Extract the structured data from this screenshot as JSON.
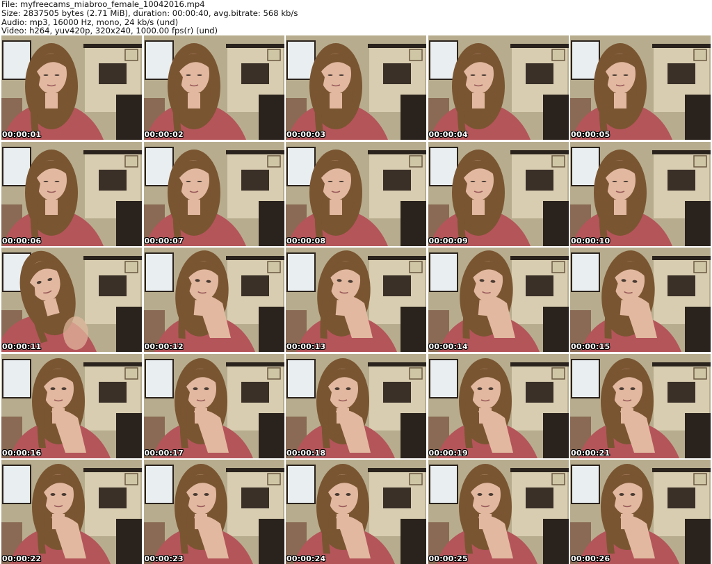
{
  "header": {
    "file_line": "File: myfreecams_miabroo_female_10042016.mp4",
    "size_line": "Size: 2837505 bytes (2.71 MiB), duration: 00:00:40, avg.bitrate: 568 kb/s",
    "audio_line": "Audio: mp3, 16000 Hz, mono, 24 kb/s (und)",
    "video_line": "Video: h264, yuv420p, 320x240, 1000.00 fps(r) (und)"
  },
  "thumbnails": [
    {
      "time": "00:00:01",
      "pose": "looking-down"
    },
    {
      "time": "00:00:02",
      "pose": "looking-down"
    },
    {
      "time": "00:00:03",
      "pose": "looking-down"
    },
    {
      "time": "00:00:04",
      "pose": "looking-down"
    },
    {
      "time": "00:00:05",
      "pose": "looking-down"
    },
    {
      "time": "00:00:06",
      "pose": "looking-down"
    },
    {
      "time": "00:00:07",
      "pose": "looking-down"
    },
    {
      "time": "00:00:08",
      "pose": "looking-down"
    },
    {
      "time": "00:00:09",
      "pose": "looking-down"
    },
    {
      "time": "00:00:10",
      "pose": "looking-down"
    },
    {
      "time": "00:00:11",
      "pose": "head-tilted"
    },
    {
      "time": "00:00:12",
      "pose": "hand-to-mouth"
    },
    {
      "time": "00:00:13",
      "pose": "hand-to-mouth"
    },
    {
      "time": "00:00:14",
      "pose": "hand-to-mouth"
    },
    {
      "time": "00:00:15",
      "pose": "hand-to-mouth"
    },
    {
      "time": "00:00:16",
      "pose": "hand-to-chin"
    },
    {
      "time": "00:00:17",
      "pose": "hand-to-chin"
    },
    {
      "time": "00:00:18",
      "pose": "hand-to-chin"
    },
    {
      "time": "00:00:19",
      "pose": "hand-to-chin"
    },
    {
      "time": "00:00:21",
      "pose": "hand-to-chin"
    },
    {
      "time": "00:00:22",
      "pose": "hand-to-chin"
    },
    {
      "time": "00:00:23",
      "pose": "hand-to-chin"
    },
    {
      "time": "00:00:24",
      "pose": "hand-to-chin"
    },
    {
      "time": "00:00:25",
      "pose": "hand-to-chin"
    },
    {
      "time": "00:00:26",
      "pose": "hand-to-chin"
    }
  ],
  "colors": {
    "wall": "#b7ad8e",
    "stone": "#d8cdb0",
    "dark_furniture": "#2a221c",
    "hair": "#7a5532",
    "skin": "#e2b9a0",
    "sweater": "#b4555a",
    "window": "#e9eef0"
  }
}
